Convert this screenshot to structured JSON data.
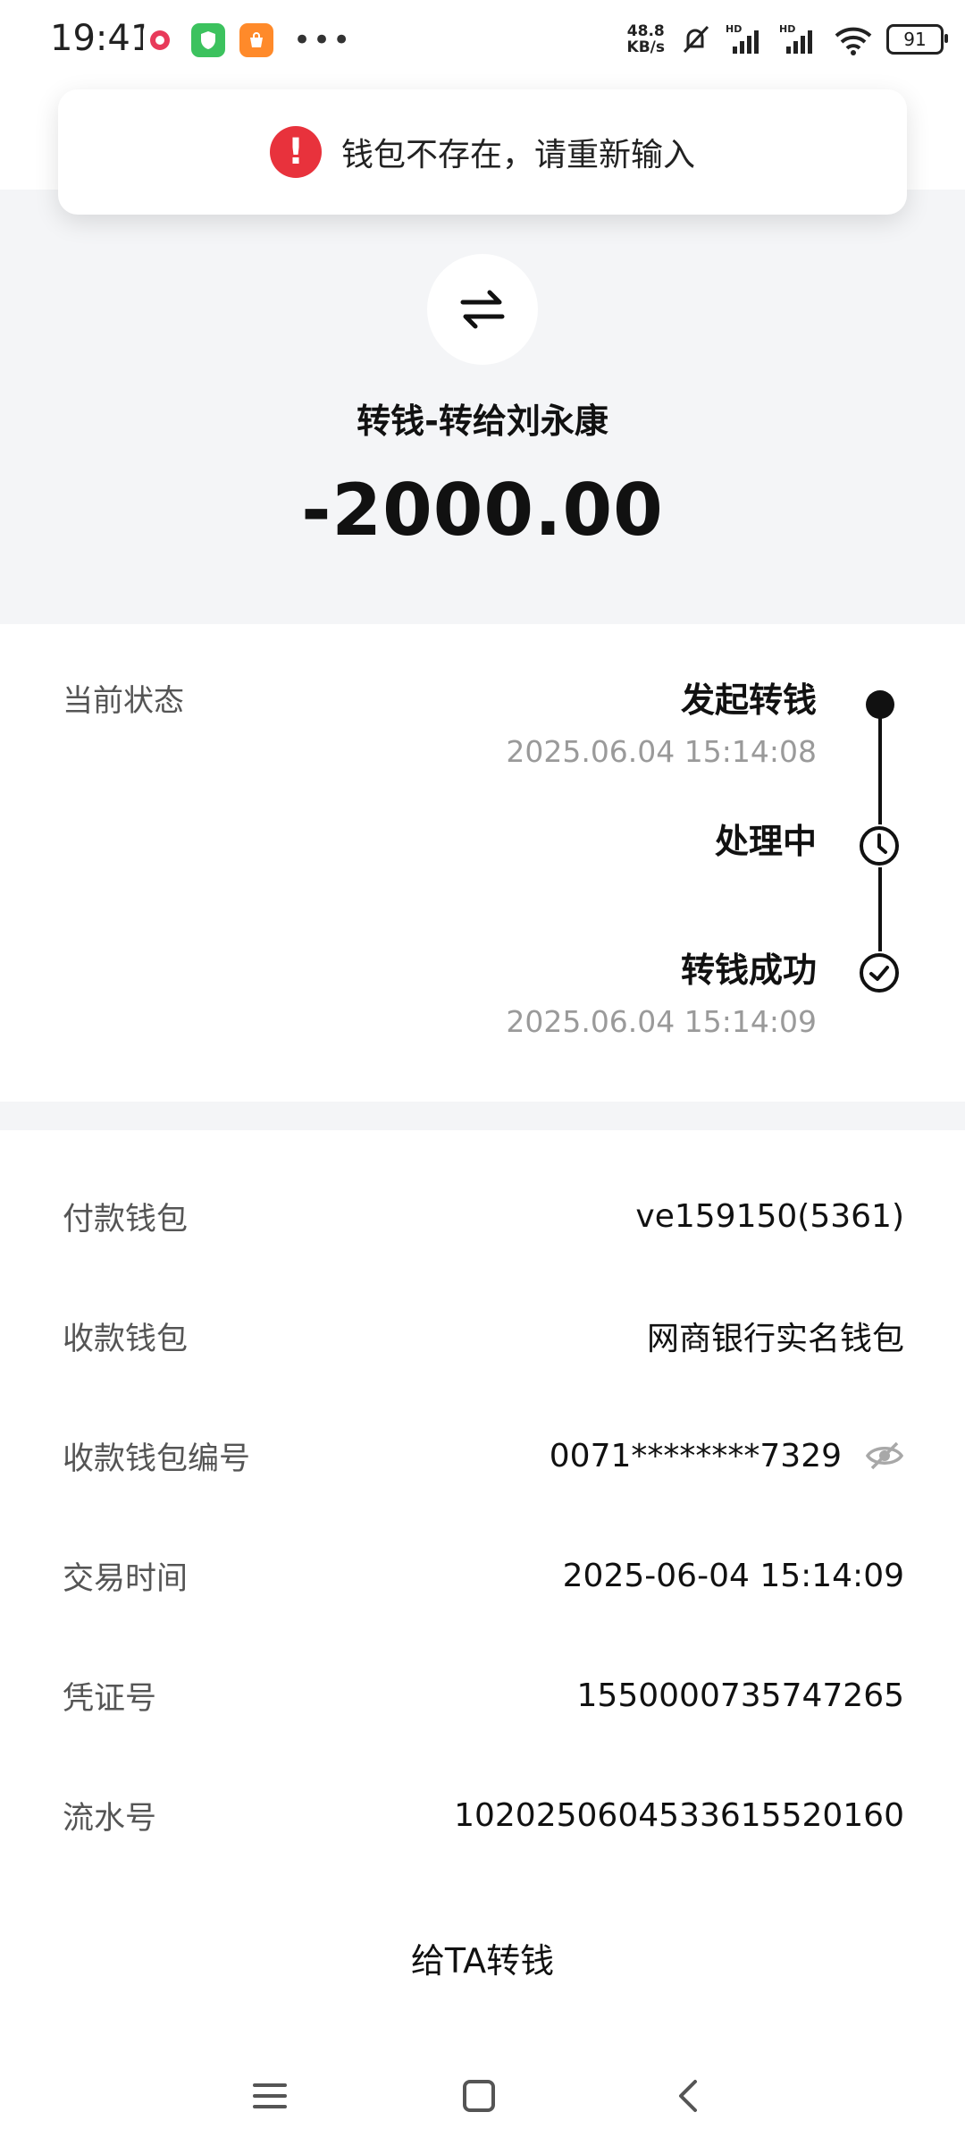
{
  "status_bar": {
    "time": "19:41",
    "net_speed_value": "48.8",
    "net_speed_unit": "KB/s",
    "battery": "91",
    "app_icons": [
      "flower-app-icon",
      "shield-app-icon",
      "shopping-app-icon"
    ]
  },
  "toast": {
    "icon": "error-exclamation-icon",
    "message": "钱包不存在，请重新输入"
  },
  "hero": {
    "icon": "transfer-arrows-icon",
    "title": "转钱-转给刘永康",
    "amount": "-2000.00"
  },
  "status": {
    "label": "当前状态",
    "steps": [
      {
        "title": "发起转钱",
        "time": "2025.06.04 15:14:08"
      },
      {
        "title": "处理中",
        "time": ""
      },
      {
        "title": "转钱成功",
        "time": "2025.06.04 15:14:09"
      }
    ]
  },
  "details": [
    {
      "label": "付款钱包",
      "value": "ve159150(5361)"
    },
    {
      "label": "收款钱包",
      "value": "网商银行实名钱包"
    },
    {
      "label": "收款钱包编号",
      "value": "0071********7329"
    },
    {
      "label": "交易时间",
      "value": "2025-06-04 15:14:09"
    },
    {
      "label": "凭证号",
      "value": "1550000735747265"
    },
    {
      "label": "流水号",
      "value": "102025060453361552016​0"
    }
  ],
  "actions": {
    "transfer_again": "给TA转钱"
  },
  "nav": [
    "menu-icon",
    "home-icon",
    "back-icon"
  ]
}
